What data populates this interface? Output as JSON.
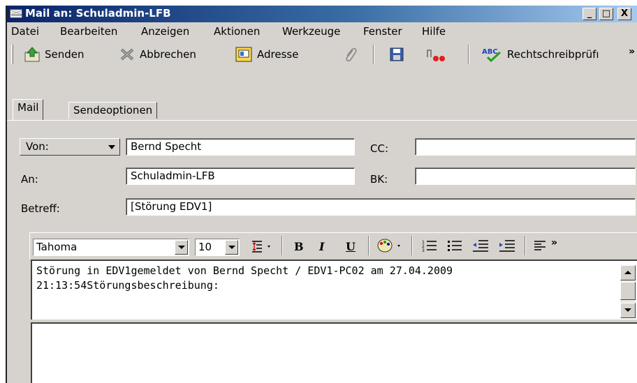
{
  "window": {
    "title": "Mail an: Schuladmin-LFB",
    "controls": {
      "minimize": "_",
      "maximize": "□",
      "close": "X"
    }
  },
  "menu": [
    "Datei",
    "Bearbeiten",
    "Anzeigen",
    "Aktionen",
    "Werkzeuge",
    "Fenster",
    "Hilfe"
  ],
  "toolbar": {
    "send_label": "Senden",
    "cancel_label": "Abbrechen",
    "address_label": "Adresse",
    "spell_label": "Rechtschreibprüfı",
    "overflow": "»",
    "abc_text": "ABC"
  },
  "tabs": [
    "Mail",
    "Sendeoptionen"
  ],
  "form": {
    "from_label": "Von:",
    "from_value": "Bernd Specht",
    "to_label": "An:",
    "to_value": "Schuladmin-LFB",
    "subject_label": "Betreff:",
    "subject_value": "[Störung EDV1]",
    "cc_label": "CC:",
    "cc_value": "",
    "bcc_label": "BK:",
    "bcc_value": ""
  },
  "format": {
    "font": "Tahoma",
    "size": "10",
    "bold": "B",
    "italic": "I",
    "underline": "U",
    "overflow": "»"
  },
  "message": {
    "text": "Störung in EDV1gemeldet von Bernd Specht / EDV1-PC02 am 27.04.2009\n21:13:54Störungsbeschreibung:"
  },
  "colors": {
    "titlebar_start": "#0a246a",
    "titlebar_end": "#a6caf0",
    "chrome": "#d6d3ce"
  }
}
